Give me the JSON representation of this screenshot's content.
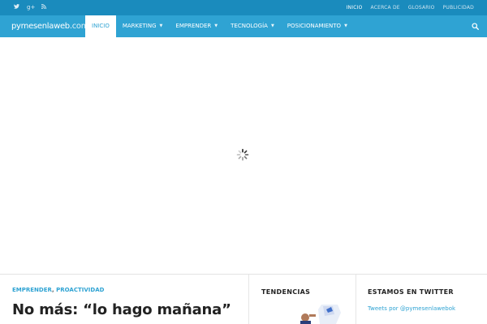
{
  "topbar": {
    "social_icons": [
      {
        "icon": "twitter-icon",
        "glyph": "🐦"
      },
      {
        "icon": "google-plus-icon",
        "glyph": "g+"
      },
      {
        "icon": "rss-icon",
        "glyph": "◔"
      }
    ],
    "links": [
      {
        "label": "INICIO",
        "active": true
      },
      {
        "label": "ACERCA DE",
        "active": false
      },
      {
        "label": "GLOSARIO",
        "active": false
      },
      {
        "label": "PUBLICIDAD",
        "active": false
      }
    ]
  },
  "navbar": {
    "logo_main": "pymesenlaweb",
    "logo_suffix": ".com",
    "menu": [
      {
        "label": "INICIO",
        "active": true,
        "dropdown": false
      },
      {
        "label": "MARKETING",
        "active": false,
        "dropdown": true
      },
      {
        "label": "EMPRENDER",
        "active": false,
        "dropdown": true
      },
      {
        "label": "TECNOLOGÍA",
        "active": false,
        "dropdown": true
      },
      {
        "label": "POSICIONAMIENTO",
        "active": false,
        "dropdown": true
      }
    ],
    "search_icon": "search-icon"
  },
  "slider": {
    "loading_icon": "loading-spinner-icon"
  },
  "post": {
    "category_1": "EMPRENDER",
    "category_sep": ",",
    "category_2": "PROACTIVIDAD",
    "title": "No más: “lo hago mañana”"
  },
  "widgets": {
    "tendencias_title": "TENDENCIAS",
    "twitter_title": "ESTAMOS EN TWITTER",
    "twitter_link": "Tweets por @pymesenlawebok"
  },
  "colors": {
    "topbar_bg": "#1a8bbd",
    "navbar_bg": "#2fa3d3",
    "accent": "#2fa3d3",
    "text_dark": "#222222"
  }
}
